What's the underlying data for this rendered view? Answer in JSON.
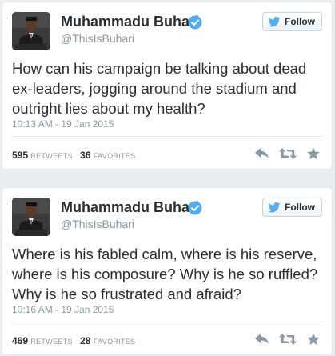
{
  "colors": {
    "verified_blue": "#55acee",
    "twitter_blue": "#55acee",
    "text_primary": "#292f33",
    "text_secondary": "#8899a6",
    "action_icon": "#8899a6"
  },
  "tweets": [
    {
      "name": "Muhammadu Buhari",
      "handle": "@ThisIsBuhari",
      "follow_label": "Follow",
      "text": "How can his campaign be talking about dead ex-leaders, jogging around the stadium and outright lies about my health?",
      "timestamp": "10:13 AM - 19 Jan 2015",
      "retweets": "595",
      "retweets_label": "RETWEETS",
      "favorites": "36",
      "favorites_label": "FAVORITES",
      "icons": [
        "reply-icon",
        "retweet-icon",
        "favorite-icon"
      ]
    },
    {
      "name": "Muhammadu Buhari",
      "handle": "@ThisIsBuhari",
      "follow_label": "Follow",
      "text": "Where is his fabled calm, where is his reserve, where is his composure? Why is he so ruffled? Why is he so frustrated and afraid?",
      "timestamp": "10:16 AM - 19 Jan 2015",
      "retweets": "469",
      "retweets_label": "RETWEETS",
      "favorites": "28",
      "favorites_label": "FAVORITES",
      "icons": [
        "reply-icon",
        "retweet-icon",
        "favorite-icon"
      ]
    }
  ]
}
